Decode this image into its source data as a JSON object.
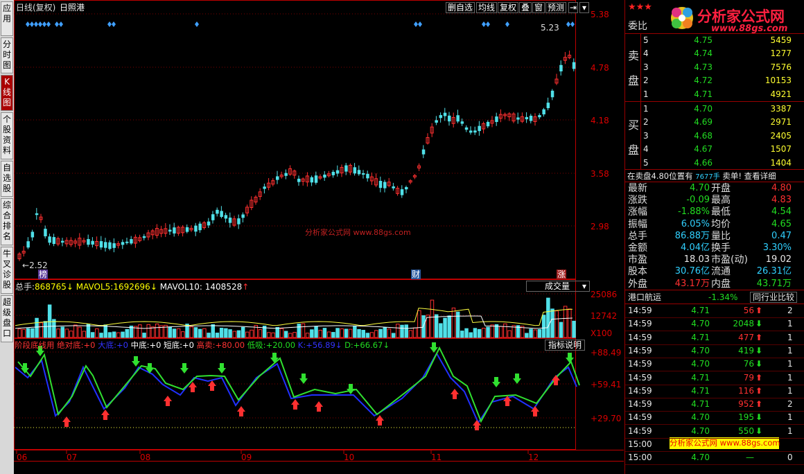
{
  "chart": {
    "title": "日线(复权)",
    "stock_name": "日照港",
    "toolbar": [
      "删自选",
      "均线",
      "复权",
      "叠",
      "窗",
      "预测"
    ],
    "price_axis": [
      "5.38",
      "4.78",
      "4.18",
      "3.58",
      "2.98"
    ],
    "high_mark": "5.23",
    "low_mark": "2.52",
    "event_badges": [
      "榜",
      "财",
      "涨"
    ],
    "volume_header": {
      "label": "总手:",
      "total": "868765",
      "mavol5_label": "MAVOL5:",
      "mavol5": "1692696",
      "mavol10_label": "MAVOL10:",
      "mavol10": "1408528"
    },
    "volume_dropdown": "成交量",
    "volume_axis": [
      "25086",
      "12742",
      "X100"
    ],
    "indicator_header": {
      "name": "阶段底线用",
      "items": [
        {
          "label": "绝对底:",
          "value": "+0"
        },
        {
          "label": "大底:",
          "value": "+0"
        },
        {
          "label": "中底:",
          "value": "+0"
        },
        {
          "label": "短底:",
          "value": "+0"
        },
        {
          "label": "高卖:",
          "value": "+80.00"
        },
        {
          "label": "低吸:",
          "value": "+20.00"
        },
        {
          "label": "K:",
          "value": "+56.89"
        },
        {
          "label": "D:",
          "value": "+66.67"
        }
      ]
    },
    "indicator_button": "指标说明",
    "indicator_axis": [
      "+88.49",
      "+59.41",
      "+29.70"
    ],
    "x_axis": [
      "06",
      "07",
      "08",
      "09",
      "10",
      "11",
      "12"
    ],
    "watermark": "分析家公式网 www.88gs.com"
  },
  "quote": {
    "header_label": "委比",
    "stars": "★★★",
    "logo": "分析家公式网",
    "logo_url": "www.88gs.com",
    "sell_label": [
      "卖",
      "盘"
    ],
    "buy_label": [
      "买",
      "盘"
    ],
    "sell": [
      {
        "n": "5",
        "price": "4.75",
        "vol": "5459"
      },
      {
        "n": "4",
        "price": "4.74",
        "vol": "1277"
      },
      {
        "n": "3",
        "price": "4.73",
        "vol": "7576"
      },
      {
        "n": "2",
        "price": "4.72",
        "vol": "10153"
      },
      {
        "n": "1",
        "price": "4.71",
        "vol": "4921"
      }
    ],
    "buy": [
      {
        "n": "1",
        "price": "4.70",
        "vol": "3387"
      },
      {
        "n": "2",
        "price": "4.69",
        "vol": "2971"
      },
      {
        "n": "3",
        "price": "4.68",
        "vol": "2405"
      },
      {
        "n": "4",
        "price": "4.67",
        "vol": "1507"
      },
      {
        "n": "5",
        "price": "4.66",
        "vol": "1404"
      }
    ],
    "notice": {
      "prefix": "在卖盘4.80位置有",
      "amount": "7677手",
      "suffix": "卖单!",
      "link": "查看详细"
    },
    "stats": [
      {
        "l1": "最新",
        "v1": "4.70",
        "c1": "green",
        "l2": "开盘",
        "v2": "4.80",
        "c2": "red"
      },
      {
        "l1": "涨跌",
        "v1": "-0.09",
        "c1": "green",
        "l2": "最高",
        "v2": "4.83",
        "c2": "red"
      },
      {
        "l1": "涨幅",
        "v1": "-1.88%",
        "c1": "green",
        "l2": "最低",
        "v2": "4.54",
        "c2": "green"
      },
      {
        "l1": "振幅",
        "v1": "6.05%",
        "c1": "cyan",
        "l2": "均价",
        "v2": "4.65",
        "c2": "green"
      },
      {
        "l1": "总手",
        "v1": "86.88万",
        "c1": "cyan",
        "l2": "量比",
        "v2": "0.47",
        "c2": "cyan"
      },
      {
        "l1": "金额",
        "v1": "4.04亿",
        "c1": "cyan",
        "l2": "换手",
        "v2": "3.30%",
        "c2": "cyan"
      },
      {
        "l1": "市盈",
        "v1": "18.03",
        "c1": "white",
        "l2": "市盈(动)",
        "v2": "19.02",
        "c2": "white"
      },
      {
        "l1": "股本",
        "v1": "30.76亿",
        "c1": "cyan",
        "l2": "流通",
        "v2": "26.31亿",
        "c2": "cyan"
      },
      {
        "l1": "外盘",
        "v1": "43.17万",
        "c1": "red",
        "l2": "内盘",
        "v2": "43.71万",
        "c2": "green"
      }
    ],
    "sector": {
      "name": "港口航运",
      "change": "-1.34%",
      "compare": "同行业比较"
    },
    "ticks": [
      {
        "time": "14:59",
        "price": "4.71",
        "vol": "56",
        "dir": "up",
        "n": "2"
      },
      {
        "time": "14:59",
        "price": "4.70",
        "vol": "2048",
        "dir": "down",
        "n": "1"
      },
      {
        "time": "14:59",
        "price": "4.71",
        "vol": "477",
        "dir": "up",
        "n": "1"
      },
      {
        "time": "14:59",
        "price": "4.70",
        "vol": "419",
        "dir": "down",
        "n": "1"
      },
      {
        "time": "14:59",
        "price": "4.70",
        "vol": "76",
        "dir": "down",
        "n": "1"
      },
      {
        "time": "14:59",
        "price": "4.71",
        "vol": "79",
        "dir": "up",
        "n": "1"
      },
      {
        "time": "14:59",
        "price": "4.71",
        "vol": "116",
        "dir": "up",
        "n": "1"
      },
      {
        "time": "14:59",
        "price": "4.71",
        "vol": "952",
        "dir": "up",
        "n": "2"
      },
      {
        "time": "14:59",
        "price": "4.70",
        "vol": "195",
        "dir": "down",
        "n": "1"
      },
      {
        "time": "14:59",
        "price": "4.70",
        "vol": "550",
        "dir": "down",
        "n": "1"
      },
      {
        "time": "15:00",
        "price": "",
        "vol": "",
        "dir": "",
        "n": ""
      },
      {
        "time": "15:00",
        "price": "4.70",
        "vol": "—",
        "dir": "",
        "n": "0"
      }
    ],
    "banner": "分析家公式网 www.88gs.com"
  },
  "left_tabs": [
    "应用",
    "分时图",
    "K线图",
    "个股资料",
    "自选股",
    "综合排名",
    "牛叉诊股",
    "超级盘口"
  ],
  "colors": {
    "up": "#ff3030",
    "down": "#50e0e8",
    "grid": "#800000",
    "axis": "#c00000"
  }
}
